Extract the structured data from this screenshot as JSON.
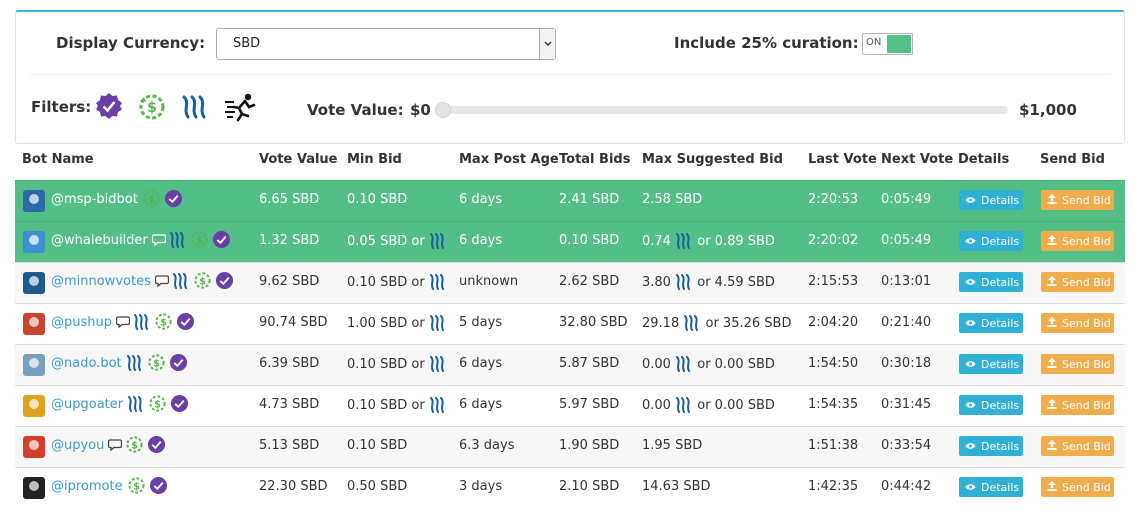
{
  "top": {
    "currency_label": "Display Currency:",
    "currency_value": "SBD",
    "curation_label": "Include 25% curation:",
    "curation_toggle": "ON",
    "filters_label": "Filters:",
    "filter_icons": [
      "verified-icon",
      "refund-icon",
      "steem-icon",
      "fast-runner-icon"
    ],
    "vote_value_label": "Vote Value:",
    "vote_min": "$0",
    "vote_max": "$1,000",
    "vote_value_fraction": 0
  },
  "table": {
    "headers": [
      "Bot Name",
      "Vote Value",
      "Min Bid",
      "Max Post Age",
      "Total Bids",
      "Max Suggested Bid",
      "Last Vote",
      "Next Vote",
      "Details",
      "Send Bid"
    ],
    "details_label": "Details",
    "send_label": "Send Bid",
    "rows": [
      {
        "name": "@msp-bidbot",
        "vote": "6.65 SBD",
        "min_bid": "0.10 SBD",
        "min_steem": false,
        "age": "6 days",
        "total": "2.41 SBD",
        "max_a": "2.58 SBD",
        "max_steem": false,
        "max_b": "",
        "last": "2:20:53",
        "next": "0:05:49",
        "comment": false,
        "steem": false,
        "refund": true,
        "verified": true
      },
      {
        "name": "@whalebuilder",
        "vote": "1.32 SBD",
        "min_bid": "0.05 SBD or",
        "min_steem": true,
        "age": "6 days",
        "total": "0.10 SBD",
        "max_a": "0.74",
        "max_steem": true,
        "max_b": "or 0.89 SBD",
        "last": "2:20:02",
        "next": "0:05:49",
        "comment": true,
        "steem": true,
        "refund": true,
        "verified": true
      },
      {
        "name": "@minnowvotes",
        "vote": "9.62 SBD",
        "min_bid": "0.10 SBD or",
        "min_steem": true,
        "age": "unknown",
        "total": "2.62 SBD",
        "max_a": "3.80",
        "max_steem": true,
        "max_b": "or 4.59 SBD",
        "last": "2:15:53",
        "next": "0:13:01",
        "comment": true,
        "steem": true,
        "refund": true,
        "verified": true
      },
      {
        "name": "@pushup",
        "vote": "90.74 SBD",
        "min_bid": "1.00 SBD or",
        "min_steem": true,
        "age": "5 days",
        "total": "32.80 SBD",
        "max_a": "29.18",
        "max_steem": true,
        "max_b": "or 35.26 SBD",
        "last": "2:04:20",
        "next": "0:21:40",
        "comment": true,
        "steem": true,
        "refund": true,
        "verified": true
      },
      {
        "name": "@nado.bot",
        "vote": "6.39 SBD",
        "min_bid": "0.10 SBD or",
        "min_steem": true,
        "age": "6 days",
        "total": "5.87 SBD",
        "max_a": "0.00",
        "max_steem": true,
        "max_b": "or 0.00 SBD",
        "last": "1:54:50",
        "next": "0:30:18",
        "comment": false,
        "steem": true,
        "refund": true,
        "verified": true
      },
      {
        "name": "@upgoater",
        "vote": "4.73 SBD",
        "min_bid": "0.10 SBD or",
        "min_steem": true,
        "age": "6 days",
        "total": "5.97 SBD",
        "max_a": "0.00",
        "max_steem": true,
        "max_b": "or 0.00 SBD",
        "last": "1:54:35",
        "next": "0:31:45",
        "comment": false,
        "steem": true,
        "refund": true,
        "verified": true
      },
      {
        "name": "@upyou",
        "vote": "5.13 SBD",
        "min_bid": "0.10 SBD",
        "min_steem": false,
        "age": "6.3 days",
        "total": "1.90 SBD",
        "max_a": "1.95 SBD",
        "max_steem": false,
        "max_b": "",
        "last": "1:51:38",
        "next": "0:33:54",
        "comment": true,
        "steem": false,
        "refund": true,
        "verified": true
      },
      {
        "name": "@ipromote",
        "vote": "22.30 SBD",
        "min_bid": "0.50 SBD",
        "min_steem": false,
        "age": "3 days",
        "total": "2.10 SBD",
        "max_a": "14.63 SBD",
        "max_steem": false,
        "max_b": "",
        "last": "1:42:35",
        "next": "0:44:42",
        "comment": false,
        "steem": false,
        "refund": true,
        "verified": true
      }
    ]
  }
}
